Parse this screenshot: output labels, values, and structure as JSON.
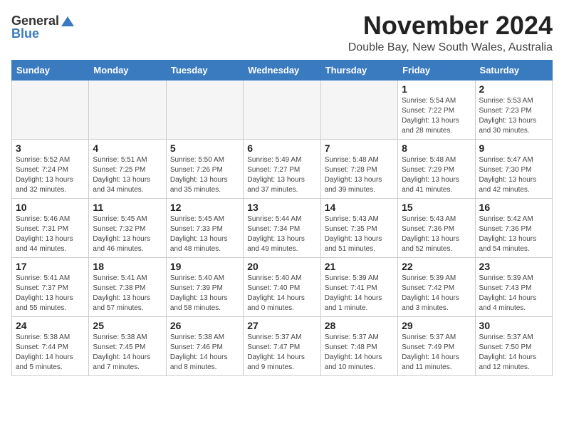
{
  "logo": {
    "general": "General",
    "blue": "Blue"
  },
  "title": "November 2024",
  "location": "Double Bay, New South Wales, Australia",
  "weekdays": [
    "Sunday",
    "Monday",
    "Tuesday",
    "Wednesday",
    "Thursday",
    "Friday",
    "Saturday"
  ],
  "weeks": [
    [
      {
        "day": "",
        "sunrise": "",
        "sunset": "",
        "daylight": "",
        "empty": true
      },
      {
        "day": "",
        "sunrise": "",
        "sunset": "",
        "daylight": "",
        "empty": true
      },
      {
        "day": "",
        "sunrise": "",
        "sunset": "",
        "daylight": "",
        "empty": true
      },
      {
        "day": "",
        "sunrise": "",
        "sunset": "",
        "daylight": "",
        "empty": true
      },
      {
        "day": "",
        "sunrise": "",
        "sunset": "",
        "daylight": "",
        "empty": true
      },
      {
        "day": "1",
        "sunrise": "Sunrise: 5:54 AM",
        "sunset": "Sunset: 7:22 PM",
        "daylight": "Daylight: 13 hours and 28 minutes.",
        "empty": false
      },
      {
        "day": "2",
        "sunrise": "Sunrise: 5:53 AM",
        "sunset": "Sunset: 7:23 PM",
        "daylight": "Daylight: 13 hours and 30 minutes.",
        "empty": false
      }
    ],
    [
      {
        "day": "3",
        "sunrise": "Sunrise: 5:52 AM",
        "sunset": "Sunset: 7:24 PM",
        "daylight": "Daylight: 13 hours and 32 minutes.",
        "empty": false
      },
      {
        "day": "4",
        "sunrise": "Sunrise: 5:51 AM",
        "sunset": "Sunset: 7:25 PM",
        "daylight": "Daylight: 13 hours and 34 minutes.",
        "empty": false
      },
      {
        "day": "5",
        "sunrise": "Sunrise: 5:50 AM",
        "sunset": "Sunset: 7:26 PM",
        "daylight": "Daylight: 13 hours and 35 minutes.",
        "empty": false
      },
      {
        "day": "6",
        "sunrise": "Sunrise: 5:49 AM",
        "sunset": "Sunset: 7:27 PM",
        "daylight": "Daylight: 13 hours and 37 minutes.",
        "empty": false
      },
      {
        "day": "7",
        "sunrise": "Sunrise: 5:48 AM",
        "sunset": "Sunset: 7:28 PM",
        "daylight": "Daylight: 13 hours and 39 minutes.",
        "empty": false
      },
      {
        "day": "8",
        "sunrise": "Sunrise: 5:48 AM",
        "sunset": "Sunset: 7:29 PM",
        "daylight": "Daylight: 13 hours and 41 minutes.",
        "empty": false
      },
      {
        "day": "9",
        "sunrise": "Sunrise: 5:47 AM",
        "sunset": "Sunset: 7:30 PM",
        "daylight": "Daylight: 13 hours and 42 minutes.",
        "empty": false
      }
    ],
    [
      {
        "day": "10",
        "sunrise": "Sunrise: 5:46 AM",
        "sunset": "Sunset: 7:31 PM",
        "daylight": "Daylight: 13 hours and 44 minutes.",
        "empty": false
      },
      {
        "day": "11",
        "sunrise": "Sunrise: 5:45 AM",
        "sunset": "Sunset: 7:32 PM",
        "daylight": "Daylight: 13 hours and 46 minutes.",
        "empty": false
      },
      {
        "day": "12",
        "sunrise": "Sunrise: 5:45 AM",
        "sunset": "Sunset: 7:33 PM",
        "daylight": "Daylight: 13 hours and 48 minutes.",
        "empty": false
      },
      {
        "day": "13",
        "sunrise": "Sunrise: 5:44 AM",
        "sunset": "Sunset: 7:34 PM",
        "daylight": "Daylight: 13 hours and 49 minutes.",
        "empty": false
      },
      {
        "day": "14",
        "sunrise": "Sunrise: 5:43 AM",
        "sunset": "Sunset: 7:35 PM",
        "daylight": "Daylight: 13 hours and 51 minutes.",
        "empty": false
      },
      {
        "day": "15",
        "sunrise": "Sunrise: 5:43 AM",
        "sunset": "Sunset: 7:36 PM",
        "daylight": "Daylight: 13 hours and 52 minutes.",
        "empty": false
      },
      {
        "day": "16",
        "sunrise": "Sunrise: 5:42 AM",
        "sunset": "Sunset: 7:36 PM",
        "daylight": "Daylight: 13 hours and 54 minutes.",
        "empty": false
      }
    ],
    [
      {
        "day": "17",
        "sunrise": "Sunrise: 5:41 AM",
        "sunset": "Sunset: 7:37 PM",
        "daylight": "Daylight: 13 hours and 55 minutes.",
        "empty": false
      },
      {
        "day": "18",
        "sunrise": "Sunrise: 5:41 AM",
        "sunset": "Sunset: 7:38 PM",
        "daylight": "Daylight: 13 hours and 57 minutes.",
        "empty": false
      },
      {
        "day": "19",
        "sunrise": "Sunrise: 5:40 AM",
        "sunset": "Sunset: 7:39 PM",
        "daylight": "Daylight: 13 hours and 58 minutes.",
        "empty": false
      },
      {
        "day": "20",
        "sunrise": "Sunrise: 5:40 AM",
        "sunset": "Sunset: 7:40 PM",
        "daylight": "Daylight: 14 hours and 0 minutes.",
        "empty": false
      },
      {
        "day": "21",
        "sunrise": "Sunrise: 5:39 AM",
        "sunset": "Sunset: 7:41 PM",
        "daylight": "Daylight: 14 hours and 1 minute.",
        "empty": false
      },
      {
        "day": "22",
        "sunrise": "Sunrise: 5:39 AM",
        "sunset": "Sunset: 7:42 PM",
        "daylight": "Daylight: 14 hours and 3 minutes.",
        "empty": false
      },
      {
        "day": "23",
        "sunrise": "Sunrise: 5:39 AM",
        "sunset": "Sunset: 7:43 PM",
        "daylight": "Daylight: 14 hours and 4 minutes.",
        "empty": false
      }
    ],
    [
      {
        "day": "24",
        "sunrise": "Sunrise: 5:38 AM",
        "sunset": "Sunset: 7:44 PM",
        "daylight": "Daylight: 14 hours and 5 minutes.",
        "empty": false
      },
      {
        "day": "25",
        "sunrise": "Sunrise: 5:38 AM",
        "sunset": "Sunset: 7:45 PM",
        "daylight": "Daylight: 14 hours and 7 minutes.",
        "empty": false
      },
      {
        "day": "26",
        "sunrise": "Sunrise: 5:38 AM",
        "sunset": "Sunset: 7:46 PM",
        "daylight": "Daylight: 14 hours and 8 minutes.",
        "empty": false
      },
      {
        "day": "27",
        "sunrise": "Sunrise: 5:37 AM",
        "sunset": "Sunset: 7:47 PM",
        "daylight": "Daylight: 14 hours and 9 minutes.",
        "empty": false
      },
      {
        "day": "28",
        "sunrise": "Sunrise: 5:37 AM",
        "sunset": "Sunset: 7:48 PM",
        "daylight": "Daylight: 14 hours and 10 minutes.",
        "empty": false
      },
      {
        "day": "29",
        "sunrise": "Sunrise: 5:37 AM",
        "sunset": "Sunset: 7:49 PM",
        "daylight": "Daylight: 14 hours and 11 minutes.",
        "empty": false
      },
      {
        "day": "30",
        "sunrise": "Sunrise: 5:37 AM",
        "sunset": "Sunset: 7:50 PM",
        "daylight": "Daylight: 14 hours and 12 minutes.",
        "empty": false
      }
    ]
  ]
}
